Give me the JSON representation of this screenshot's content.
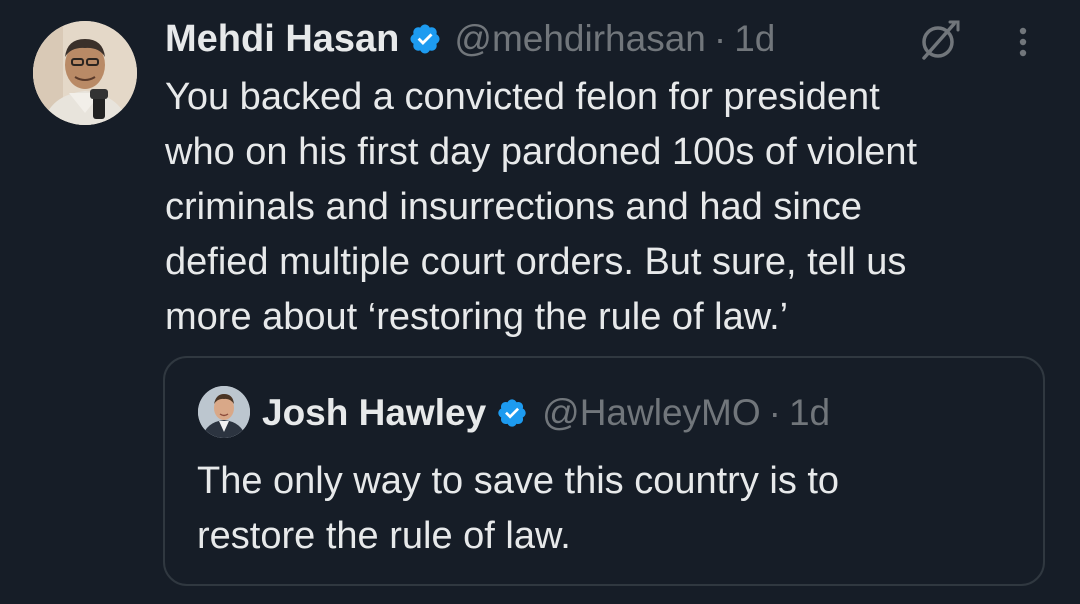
{
  "tweet": {
    "author_name": "Mehdi Hasan",
    "author_handle": "@mehdirhasan",
    "separator": "·",
    "time": "1d",
    "text": "You backed a convicted felon for president\nwho on his first day pardoned 100s of violent\ncriminals and insurrections and had since\ndefied multiple court orders. But sure, tell us\nmore about ‘restoring the rule of law.’"
  },
  "quote": {
    "author_name": "Josh Hawley",
    "author_handle": "@HawleyMO",
    "separator": "·",
    "time": "1d",
    "text": "The only way to save this country is to\nrestore the rule of law."
  },
  "icons": {
    "verified": "verified-badge-icon",
    "grok": "grok-icon",
    "more": "more-options-icon"
  },
  "colors": {
    "background": "#161d27",
    "text": "#e7e9ea",
    "secondary": "#71767b",
    "verified": "#1d9bf0",
    "border": "#303840"
  }
}
